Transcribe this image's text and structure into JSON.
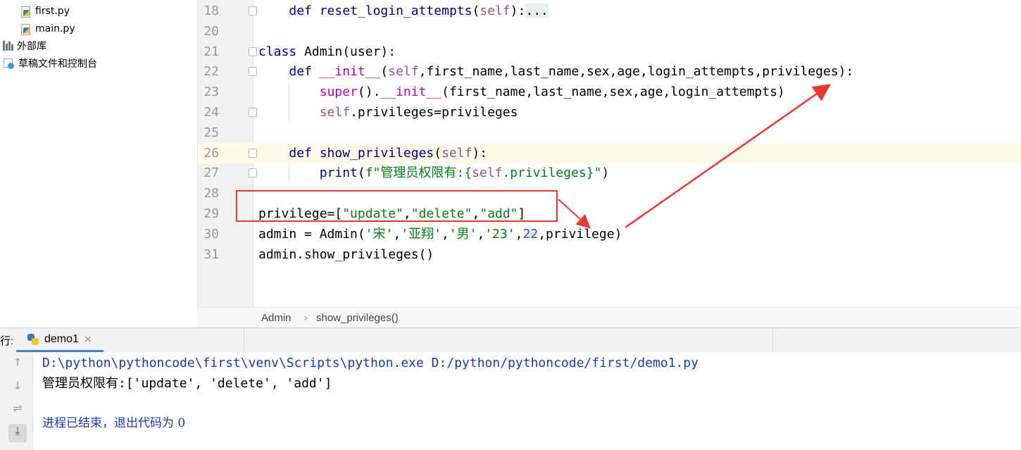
{
  "project": {
    "items": [
      {
        "label": "first.py",
        "icon": "python-file-icon"
      },
      {
        "label": "main.py",
        "icon": "python-file-icon"
      },
      {
        "label": "外部库",
        "icon": "library-icon"
      },
      {
        "label": "草稿文件和控制台",
        "icon": "scratches-icon"
      }
    ]
  },
  "editor": {
    "lines": [
      {
        "n": "18",
        "tokens": [
          [
            "",
            "    "
          ],
          [
            "kw",
            "def "
          ],
          [
            "fn",
            "reset_login_attempts"
          ],
          [
            "",
            "("
          ],
          [
            "sf",
            "self"
          ],
          [
            "",
            "):"
          ],
          [
            "fold-text",
            "..."
          ]
        ]
      },
      {
        "n": "20",
        "tokens": []
      },
      {
        "n": "21",
        "tokens": [
          [
            "kw",
            "class "
          ],
          [
            "",
            "Admin(user):"
          ]
        ]
      },
      {
        "n": "22",
        "tokens": [
          [
            "",
            "    "
          ],
          [
            "kw",
            "def "
          ],
          [
            "dn",
            "__init__"
          ],
          [
            "",
            "("
          ],
          [
            "sf",
            "self"
          ],
          [
            "",
            ",first_name,last_name,sex,age,login_attempts,privileges):"
          ]
        ]
      },
      {
        "n": "23",
        "tokens": [
          [
            "",
            "        "
          ],
          [
            "dn",
            "super"
          ],
          [
            "",
            "()."
          ],
          [
            "dn",
            "__init__"
          ],
          [
            "",
            "(first_name,last_name,sex,age,login_attempts)"
          ]
        ]
      },
      {
        "n": "24",
        "tokens": [
          [
            "",
            "        "
          ],
          [
            "sf",
            "self"
          ],
          [
            "",
            ".privileges=privileges"
          ]
        ]
      },
      {
        "n": "25",
        "tokens": []
      },
      {
        "n": "26",
        "tokens": [
          [
            "",
            "    "
          ],
          [
            "kw",
            "def "
          ],
          [
            "fn",
            "show_privileges"
          ],
          [
            "",
            "("
          ],
          [
            "sf",
            "self"
          ],
          [
            "",
            "):"
          ]
        ]
      },
      {
        "n": "27",
        "tokens": [
          [
            "",
            "        "
          ],
          [
            "kw",
            "print"
          ],
          [
            "",
            "("
          ],
          [
            "st",
            "f\"管理员权限有:{"
          ],
          [
            "sf",
            "self"
          ],
          [
            "st",
            ".privileges}\""
          ],
          [
            "",
            ")"
          ]
        ]
      },
      {
        "n": "28",
        "tokens": []
      },
      {
        "n": "29",
        "tokens": [
          [
            "",
            "privilege=["
          ],
          [
            "st",
            "\"update\""
          ],
          [
            "",
            ","
          ],
          [
            "st",
            "\"delete\""
          ],
          [
            "",
            ","
          ],
          [
            "st",
            "\"add\""
          ],
          [
            "",
            "]"
          ]
        ]
      },
      {
        "n": "30",
        "tokens": [
          [
            "",
            "admin = Admin("
          ],
          [
            "st",
            "'宋'"
          ],
          [
            "",
            ","
          ],
          [
            "st",
            "'亚翔'"
          ],
          [
            "",
            ","
          ],
          [
            "st",
            "'男'"
          ],
          [
            "",
            ","
          ],
          [
            "st",
            "'23'"
          ],
          [
            "",
            ","
          ],
          [
            "num",
            "22"
          ],
          [
            "",
            ",privilege)"
          ]
        ]
      },
      {
        "n": "31",
        "tokens": [
          [
            "",
            "admin.show_privileges()"
          ]
        ]
      }
    ]
  },
  "breadcrumb": {
    "class_name": "Admin",
    "separator": "›",
    "method": "show_privileges()"
  },
  "run_panel": {
    "label": "行:",
    "tab_label": "demo1",
    "tab_close": "×",
    "toolbar": {
      "up": "↑",
      "down": "↓",
      "wrap": "⇌",
      "scroll_end": "⤓"
    },
    "console": {
      "command": "D:\\python\\pythoncode\\first\\venv\\Scripts\\python.exe D:/python/pythoncode/first/demo1.py",
      "output": "管理员权限有:['update', 'delete', 'add']",
      "exit": "进程已结束，退出代码为 0"
    }
  },
  "colors": {
    "annotation": "#e53935",
    "current_line": "#fcfae8",
    "tab_accent": "#4083c9"
  }
}
